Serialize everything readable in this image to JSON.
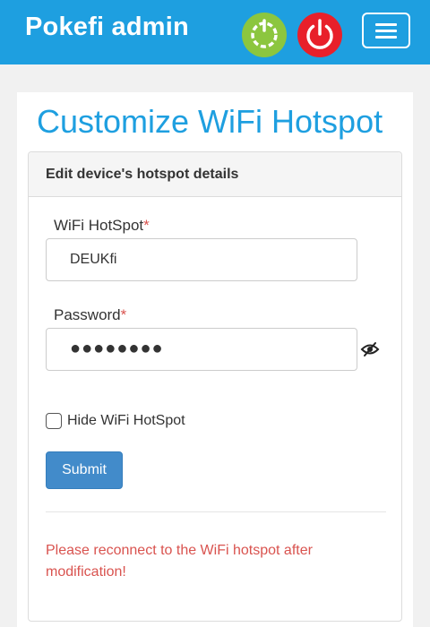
{
  "navbar": {
    "brand": "Pokefi admin",
    "reboot_icon": "reboot-icon",
    "power_icon": "power-icon",
    "menu_icon": "hamburger-menu-icon"
  },
  "page": {
    "title": "Customize WiFi Hotspot"
  },
  "card": {
    "header": "Edit device's hotspot details"
  },
  "form": {
    "ssid_label": "WiFi HotSpot",
    "ssid_value": "DEUKfi",
    "password_label": "Password",
    "password_value": "●●●●●●●●",
    "required_mark": "*",
    "hide_label": "Hide WiFi HotSpot",
    "hide_checked": false,
    "submit_label": "Submit"
  },
  "notice": "Please reconnect to the WiFi hotspot after modification!",
  "colors": {
    "navbar": "#1e9fe0",
    "reboot": "#8cc63f",
    "power": "#e8202a",
    "submit": "#428bca",
    "notice": "#d9534f"
  }
}
